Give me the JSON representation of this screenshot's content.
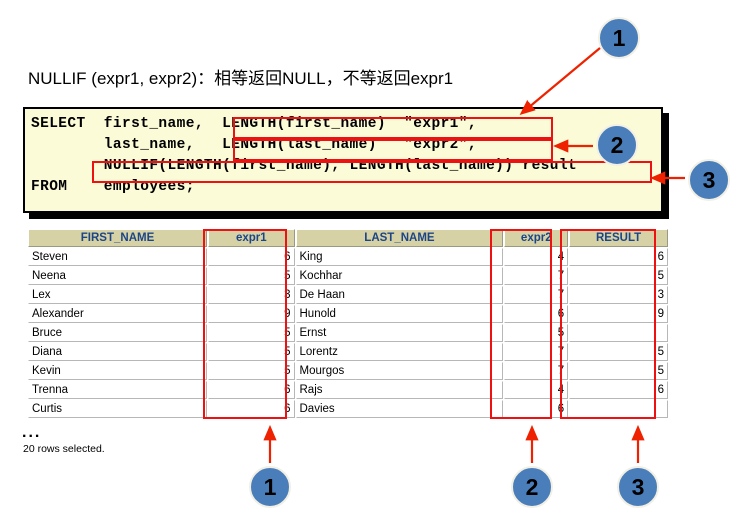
{
  "title": {
    "prefix": "NULLIF (expr1, expr2)",
    "colon": "：",
    "description": "相等返回NULL，不等返回expr1",
    "full": "NULLIF (expr1, expr2)：相等返回NULL，不等返回expr1"
  },
  "code": {
    "language": "sql",
    "lines": [
      "SELECT  first_name,  LENGTH(first_name)  \"expr1\",",
      "        last_name,   LENGTH(last_name)   \"expr2\",",
      "        NULLIF(LENGTH(first_name), LENGTH(last_name)) result",
      "FROM    employees;"
    ],
    "background_color": "#fcfbd8",
    "highlight_color": "#ee1111"
  },
  "callouts": {
    "top": [
      {
        "label": "1"
      },
      {
        "label": "2"
      },
      {
        "label": "3"
      }
    ],
    "bottom": [
      {
        "label": "1"
      },
      {
        "label": "2"
      },
      {
        "label": "3"
      }
    ],
    "badge_color": "#4a7ebb",
    "arrow_color": "#ee2200"
  },
  "result_grid": {
    "columns": [
      "FIRST_NAME",
      "expr1",
      "LAST_NAME",
      "expr2",
      "RESULT"
    ],
    "header_background": "#d6d2a6",
    "header_text_color": "#1c4587",
    "rows": [
      {
        "first_name": "Steven",
        "expr1": "6",
        "last_name": "King",
        "expr2": "4",
        "result": "6"
      },
      {
        "first_name": "Neena",
        "expr1": "5",
        "last_name": "Kochhar",
        "expr2": "7",
        "result": "5"
      },
      {
        "first_name": "Lex",
        "expr1": "3",
        "last_name": "De Haan",
        "expr2": "7",
        "result": "3"
      },
      {
        "first_name": "Alexander",
        "expr1": "9",
        "last_name": "Hunold",
        "expr2": "6",
        "result": "9"
      },
      {
        "first_name": "Bruce",
        "expr1": "5",
        "last_name": "Ernst",
        "expr2": "5",
        "result": ""
      },
      {
        "first_name": "Diana",
        "expr1": "5",
        "last_name": "Lorentz",
        "expr2": "7",
        "result": "5"
      },
      {
        "first_name": "Kevin",
        "expr1": "5",
        "last_name": "Mourgos",
        "expr2": "7",
        "result": "5"
      },
      {
        "first_name": "Trenna",
        "expr1": "6",
        "last_name": "Rajs",
        "expr2": "4",
        "result": "6"
      },
      {
        "first_name": "Curtis",
        "expr1": "6",
        "last_name": "Davies",
        "expr2": "6",
        "result": ""
      }
    ],
    "ellipsis": "...",
    "row_count_text": "20 rows selected."
  }
}
